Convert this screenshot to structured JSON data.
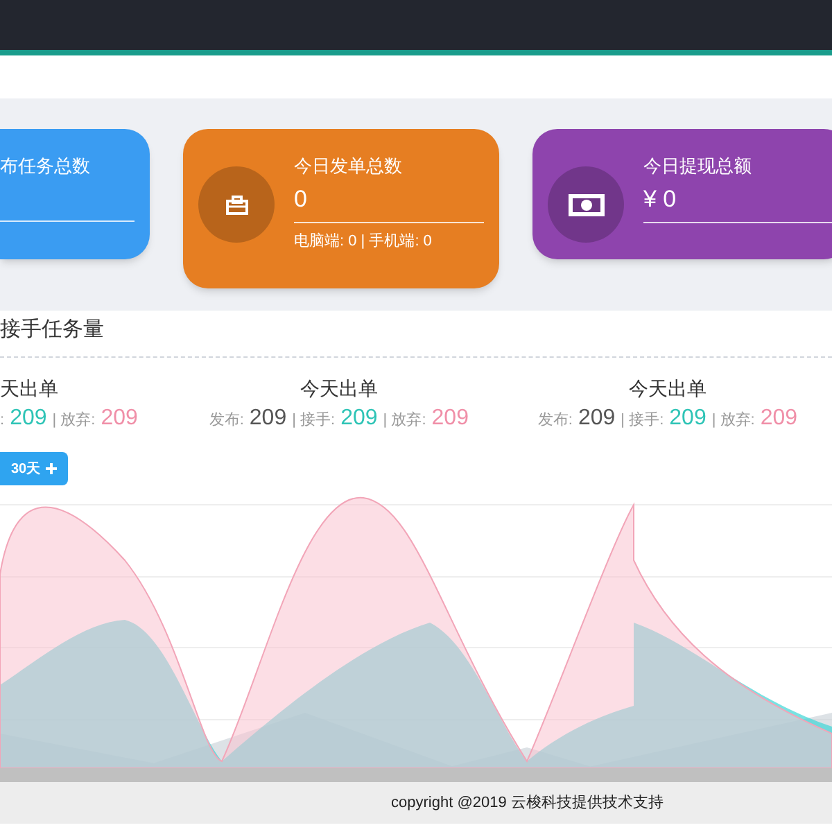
{
  "cards": [
    {
      "kind": "tasks",
      "title": "布任务总数",
      "color": "#3a9cf2"
    },
    {
      "kind": "orders",
      "title": "今日发单总数",
      "value": "0",
      "sub": "电脑端: 0 | 手机端: 0",
      "color": "#e67e22"
    },
    {
      "kind": "withdrawals",
      "title": "今日提现总额",
      "value": "¥ 0",
      "color": "#8e44ad"
    }
  ],
  "chart_section": {
    "title": "接手任务量",
    "columns": [
      {
        "title": "天出单",
        "items": [
          {
            "kind": "accepted",
            "label": ":",
            "value": "209"
          },
          {
            "kind": "abandoned",
            "label": "| 放弃:",
            "value": "209"
          }
        ]
      },
      {
        "title": "今天出单",
        "items": [
          {
            "kind": "published",
            "label": "发布:",
            "value": "209"
          },
          {
            "kind": "accepted",
            "label": "| 接手:",
            "value": "209"
          },
          {
            "kind": "abandoned",
            "label": "| 放弃:",
            "value": "209"
          }
        ]
      },
      {
        "title": "今天出单",
        "items": [
          {
            "kind": "published",
            "label": "发布:",
            "value": "209"
          },
          {
            "kind": "accepted",
            "label": "| 接手:",
            "value": "209"
          },
          {
            "kind": "abandoned",
            "label": "| 放弃:",
            "value": "209"
          }
        ]
      }
    ],
    "range_button": "30天"
  },
  "footer": "copyright @2019 云梭科技提供技术支持"
}
